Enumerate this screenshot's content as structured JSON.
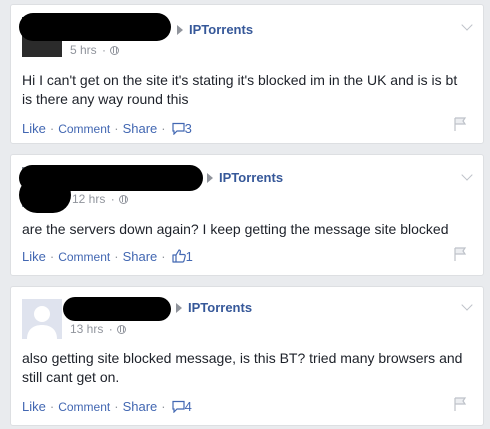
{
  "posts": [
    {
      "page": "IPTorrents",
      "time": "5 hrs",
      "message": "Hi I can't get on the site it's stating it's blocked im in the UK and is is bt is there any way round this",
      "actions": {
        "like": "Like",
        "comment": "Comment",
        "share": "Share"
      },
      "count": "3",
      "count_icon": "comment-icon"
    },
    {
      "page": "IPTorrents",
      "time": "12 hrs",
      "message": "are the servers down again? I keep getting the message site blocked",
      "actions": {
        "like": "Like",
        "comment": "Comment",
        "share": "Share"
      },
      "count": "1",
      "count_icon": "thumbs-up-icon"
    },
    {
      "page": "IPTorrents",
      "time": "13 hrs",
      "message": "also getting site blocked message, is this BT? tried many browsers and still cant get on.",
      "actions": {
        "like": "Like",
        "comment": "Comment",
        "share": "Share"
      },
      "count": "4",
      "count_icon": "comment-icon"
    }
  ]
}
